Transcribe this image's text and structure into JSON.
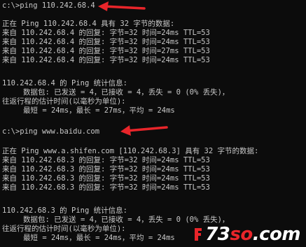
{
  "window": {
    "type": "command-prompt"
  },
  "session1": {
    "command": "c:\\>ping 110.242.68.4",
    "header": "正在 Ping 110.242.68.4 具有 32 字节的数据:",
    "replies": [
      "来自 110.242.68.4 的回复: 字节=32 时间=24ms TTL=53",
      "来自 110.242.68.4 的回复: 字节=32 时间=24ms TTL=53",
      "来自 110.242.68.4 的回复: 字节=32 时间=27ms TTL=53",
      "来自 110.242.68.4 的回复: 字节=32 时间=24ms TTL=53"
    ],
    "stats_title": "110.242.68.4 的 Ping 统计信息:",
    "packets": "数据包: 已发送 = 4，已接收 = 4，丢失 = 0 (0% 丢失)，",
    "rtt_title": "往返行程的估计时间(以毫秒为单位):",
    "rtt": "最短 = 24ms，最长 = 27ms，平均 = 24ms"
  },
  "session2": {
    "command": "c:\\>ping www.baidu.com",
    "header": "正在 Ping www.a.shifen.com [110.242.68.3] 具有 32 字节的数据:",
    "replies": [
      "来自 110.242.68.3 的回复: 字节=32 时间=24ms TTL=53",
      "来自 110.242.68.3 的回复: 字节=32 时间=24ms TTL=53",
      "来自 110.242.68.3 的回复: 字节=32 时间=24ms TTL=53",
      "来自 110.242.68.3 的回复: 字节=32 时间=24ms TTL=53"
    ],
    "stats_title": "110.242.68.3 的 Ping 统计信息:",
    "packets": "数据包: 已发送 = 4，已接收 = 4，丢失 = 0 (0% 丢失)，",
    "rtt_title": "往返行程的估计时间(以毫秒为单位):",
    "rtt": "最短 = 24ms，最长 = 24ms，平均 = 24ms"
  },
  "annotations": {
    "arrow_color": "#e8252a",
    "arrow_icon": "red-arrow-icon"
  },
  "watermark": {
    "prefix": "73",
    "accent": "so",
    "suffix": ".com",
    "icon": "site-logo-icon"
  },
  "colors": {
    "background": "#0c0c0c",
    "text": "#c8c8c8"
  }
}
